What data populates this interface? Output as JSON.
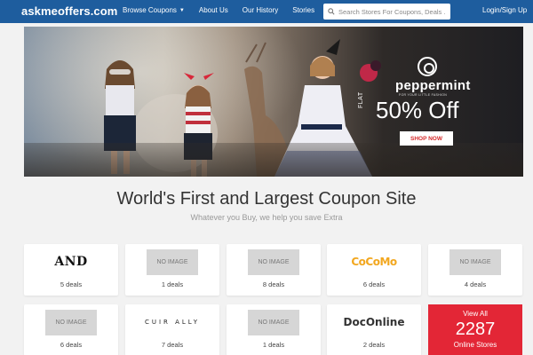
{
  "header": {
    "logo": "askmeoffers.com",
    "nav": [
      "Browse Coupons",
      "About Us",
      "Our History",
      "Stories"
    ],
    "search_placeholder": "Search Stores For Coupons, Deals ...",
    "login": "Login/Sign Up"
  },
  "hero": {
    "brand": "peppermint",
    "brand_tagline": "FOR YOUR LITTLE FASHION",
    "flat": "FLAT",
    "offer": "50% Off",
    "cta": "SHOP NOW"
  },
  "main": {
    "title": "World's First and Largest Coupon Site",
    "subtitle": "Whatever you Buy, we help you save Extra"
  },
  "stores": [
    {
      "logo": "AND",
      "logo_type": "and",
      "deals": "5 deals"
    },
    {
      "logo": "NO IMAGE",
      "logo_type": "none",
      "deals": "1 deals"
    },
    {
      "logo": "NO IMAGE",
      "logo_type": "none",
      "deals": "8 deals"
    },
    {
      "logo": "CoCoMo",
      "logo_type": "cocomo",
      "deals": "6 deals"
    },
    {
      "logo": "NO IMAGE",
      "logo_type": "none",
      "deals": "4 deals"
    },
    {
      "logo": "NO IMAGE",
      "logo_type": "none",
      "deals": "6 deals"
    },
    {
      "logo": "CUIR ALLY",
      "logo_type": "cuir",
      "deals": "7 deals"
    },
    {
      "logo": "NO IMAGE",
      "logo_type": "none",
      "deals": "1 deals"
    },
    {
      "logo": "DocOnline",
      "logo_type": "doc",
      "deals": "2 deals"
    }
  ],
  "view_all": {
    "label": "View All",
    "count": "2287",
    "suffix": "Online Stores"
  },
  "colors": {
    "header_bg": "#1e5d9e",
    "view_all_bg": "#e32636",
    "cta_text": "#d62a2a"
  },
  "icons": {
    "search": "search-icon",
    "nav_dropdown": "chevron-down-icon"
  }
}
